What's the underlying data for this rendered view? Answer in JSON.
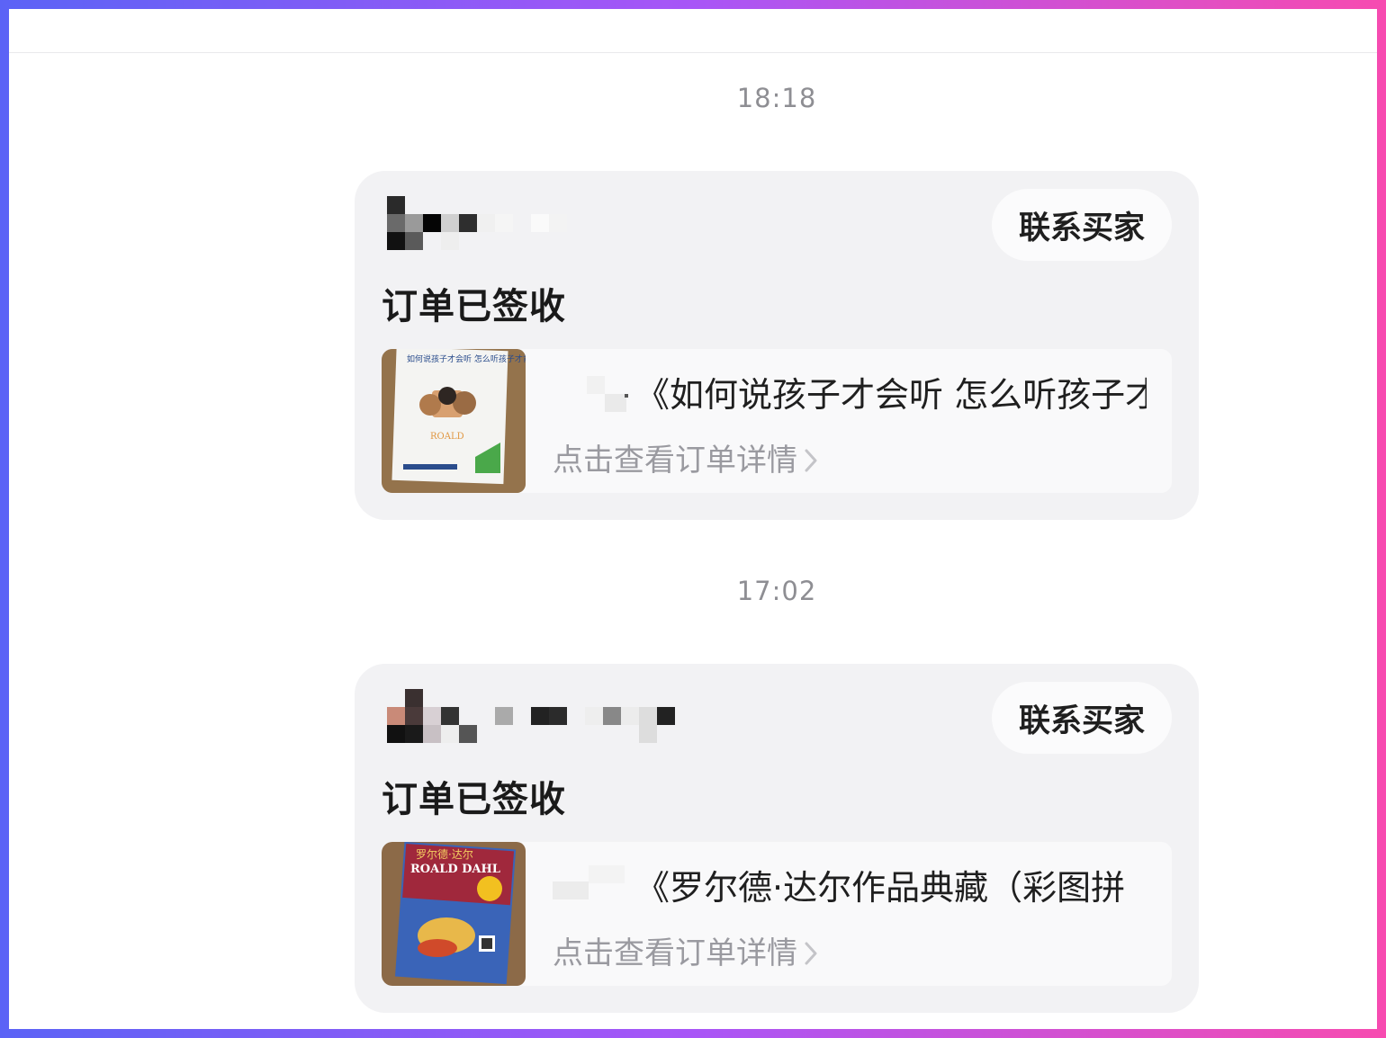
{
  "messages": [
    {
      "time": "18:18",
      "contact_button": "联系买家",
      "status": "订单已签收",
      "product_title": "《如何说孩子才会听 怎么听孩子才",
      "detail_link": "点击查看订单详情",
      "thumbnail": {
        "cover_title": "如何说孩子才会听 怎么听孩子才肯说",
        "cover_subtitle": "ROALD"
      }
    },
    {
      "time": "17:02",
      "contact_button": "联系买家",
      "status": "订单已签收",
      "product_title": "《罗尔德·达尔作品典藏（彩图拼",
      "detail_link": "点击查看订单详情",
      "thumbnail": {
        "cover_title": "罗尔德·达尔",
        "cover_subtitle": "ROALD DAHL"
      }
    }
  ],
  "icons": {
    "chevron": "chevron-right-icon"
  },
  "colors": {
    "card_bg": "#f2f2f4",
    "muted_text": "#9a9aa0",
    "border_gradient_start": "#5b63f6",
    "border_gradient_end": "#f74bb0"
  }
}
